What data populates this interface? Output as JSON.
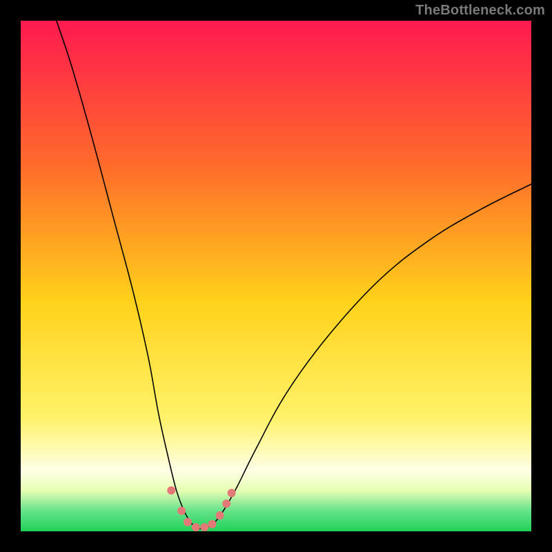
{
  "watermark": "TheBottleneck.com",
  "chart_data": {
    "type": "line",
    "title": "",
    "xlabel": "",
    "ylabel": "",
    "xlim": [
      0,
      100
    ],
    "ylim": [
      0,
      100
    ],
    "grid": false,
    "legend": false,
    "background_gradient": {
      "top": "#ff1a4f",
      "mid1": "#ff6a2b",
      "mid2": "#ffd21a",
      "lower": "#fff36a",
      "pale": "#ffffe6",
      "bottom_top": "#e6ffb3",
      "bottom_mid": "#66e28a",
      "bottom": "#1fd157"
    },
    "series": [
      {
        "name": "curve-left",
        "color": "#000000",
        "width": 1.6,
        "points": [
          {
            "x": 7,
            "y": 100
          },
          {
            "x": 10,
            "y": 91
          },
          {
            "x": 14,
            "y": 77
          },
          {
            "x": 18,
            "y": 62
          },
          {
            "x": 22,
            "y": 47
          },
          {
            "x": 25,
            "y": 34
          },
          {
            "x": 27,
            "y": 23
          },
          {
            "x": 29,
            "y": 14
          },
          {
            "x": 30.5,
            "y": 8
          },
          {
            "x": 32,
            "y": 4
          },
          {
            "x": 33.5,
            "y": 1.5
          },
          {
            "x": 35,
            "y": 0.5
          }
        ]
      },
      {
        "name": "curve-right",
        "color": "#000000",
        "width": 1.6,
        "points": [
          {
            "x": 35,
            "y": 0.5
          },
          {
            "x": 37,
            "y": 1
          },
          {
            "x": 39,
            "y": 3
          },
          {
            "x": 42,
            "y": 8
          },
          {
            "x": 46,
            "y": 16
          },
          {
            "x": 52,
            "y": 27
          },
          {
            "x": 60,
            "y": 38
          },
          {
            "x": 70,
            "y": 49
          },
          {
            "x": 80,
            "y": 57
          },
          {
            "x": 90,
            "y": 63
          },
          {
            "x": 100,
            "y": 68
          }
        ]
      }
    ],
    "markers": {
      "color": "#e37a78",
      "radius": 6,
      "points": [
        {
          "x": 29.5,
          "y": 8
        },
        {
          "x": 31.5,
          "y": 4
        },
        {
          "x": 32.7,
          "y": 1.8
        },
        {
          "x": 34.3,
          "y": 0.8
        },
        {
          "x": 36.0,
          "y": 0.8
        },
        {
          "x": 37.5,
          "y": 1.4
        },
        {
          "x": 39.0,
          "y": 3.1
        },
        {
          "x": 40.3,
          "y": 5.4
        },
        {
          "x": 41.3,
          "y": 7.5
        }
      ]
    }
  }
}
